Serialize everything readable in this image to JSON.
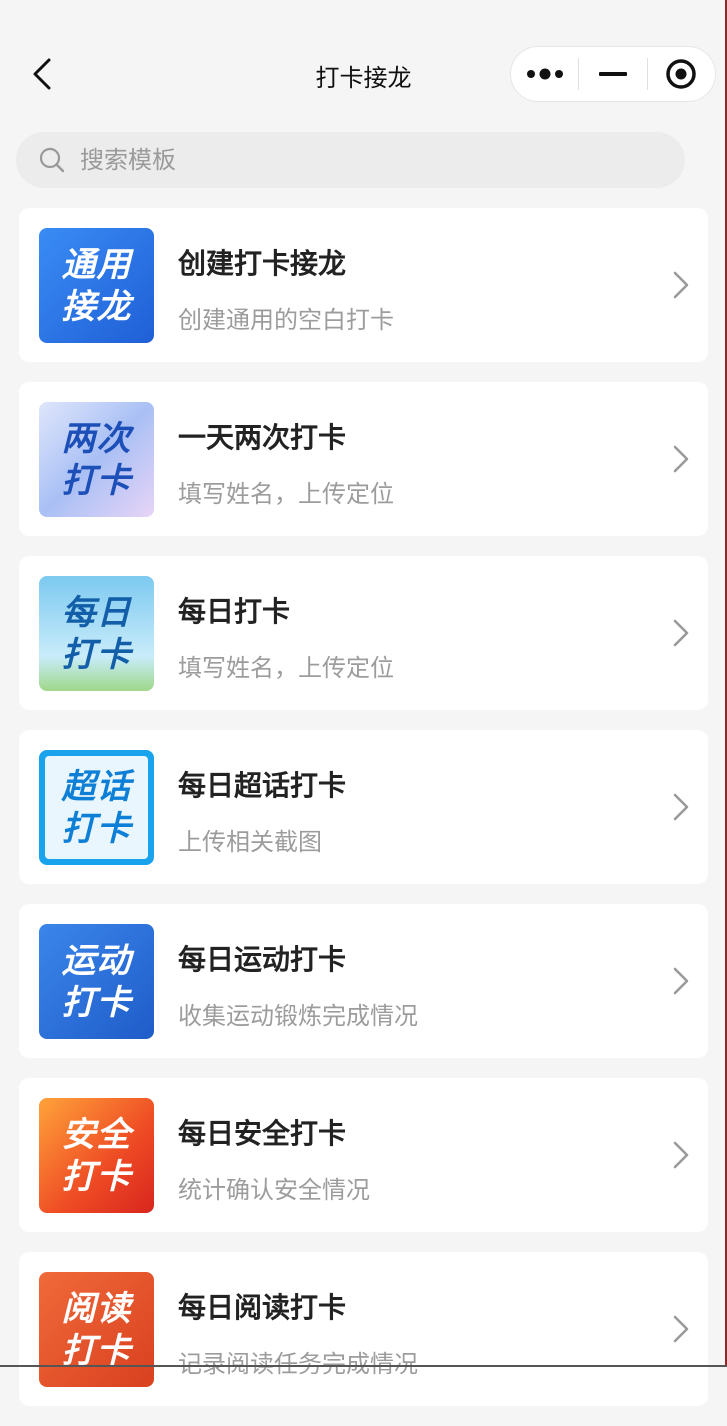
{
  "header": {
    "title": "打卡接龙"
  },
  "search": {
    "placeholder": "搜索模板"
  },
  "templates": [
    {
      "title": "创建打卡接龙",
      "subtitle": "创建通用的空白打卡",
      "thumb_line1": "通用",
      "thumb_line2": "接龙",
      "thumb_color": "#2e7cf0"
    },
    {
      "title": "一天两次打卡",
      "subtitle": "填写姓名，上传定位",
      "thumb_line1": "两次",
      "thumb_line2": "打卡",
      "thumb_color": "#b9c8f5"
    },
    {
      "title": "每日打卡",
      "subtitle": "填写姓名，上传定位",
      "thumb_line1": "每日",
      "thumb_line2": "打卡",
      "thumb_color": "#8fd4f2"
    },
    {
      "title": "每日超话打卡",
      "subtitle": "上传相关截图",
      "thumb_line1": "超话",
      "thumb_line2": "打卡",
      "thumb_color": "#1aa6ee"
    },
    {
      "title": "每日运动打卡",
      "subtitle": "收集运动锻炼完成情况",
      "thumb_line1": "运动",
      "thumb_line2": "打卡",
      "thumb_color": "#2d6fd8"
    },
    {
      "title": "每日安全打卡",
      "subtitle": "统计确认安全情况",
      "thumb_line1": "安全",
      "thumb_line2": "打卡",
      "thumb_color": "#ee5a2a"
    },
    {
      "title": "每日阅读打卡",
      "subtitle": "记录阅读任务完成情况",
      "thumb_line1": "阅读",
      "thumb_line2": "打卡",
      "thumb_color": "#e0502c"
    }
  ]
}
